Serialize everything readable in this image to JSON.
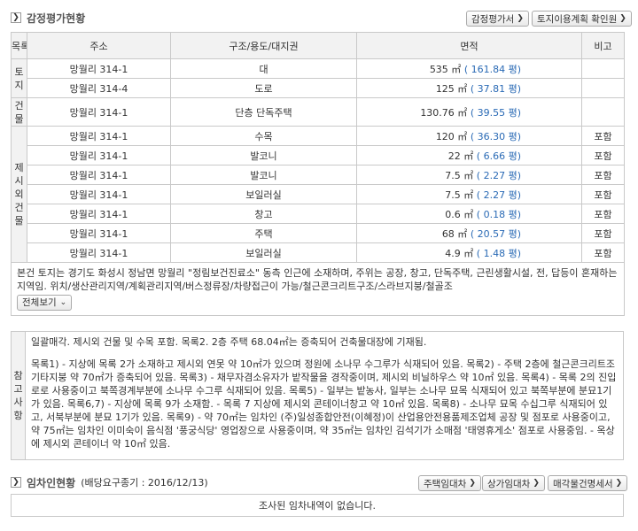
{
  "appraisal": {
    "title": "감정평가현황",
    "buttons": {
      "appraisal_doc": "감정평가서",
      "land_plan": "토지이용계획 확인원"
    },
    "headers": {
      "category": "목록",
      "address": "주소",
      "structure": "구조/용도/대지권",
      "area": "면적",
      "note": "비고"
    },
    "category_labels": {
      "land": "토지",
      "building": "건물",
      "extra": "제시외건물"
    },
    "land_rows": [
      {
        "address": "망월리 314-1",
        "structure": "대",
        "area": "535 ㎡",
        "pyeong": "( 161.84 평)",
        "note": ""
      },
      {
        "address": "망월리 314-4",
        "structure": "도로",
        "area": "125 ㎡",
        "pyeong": "( 37.81 평)",
        "note": ""
      }
    ],
    "building_rows": [
      {
        "address": "망월리 314-1",
        "structure": "단층 단독주택",
        "area": "130.76 ㎡",
        "pyeong": "( 39.55 평)",
        "note": ""
      }
    ],
    "extra_rows": [
      {
        "address": "망월리 314-1",
        "structure": "수목",
        "area": "120 ㎡",
        "pyeong": "( 36.30 평)",
        "note": "포함"
      },
      {
        "address": "망월리 314-1",
        "structure": "발코니",
        "area": "22 ㎡",
        "pyeong": "( 6.66 평)",
        "note": "포함"
      },
      {
        "address": "망월리 314-1",
        "structure": "발코니",
        "area": "7.5 ㎡",
        "pyeong": "( 2.27 평)",
        "note": "포함"
      },
      {
        "address": "망월리 314-1",
        "structure": "보일러실",
        "area": "7.5 ㎡",
        "pyeong": "( 2.27 평)",
        "note": "포함"
      },
      {
        "address": "망월리 314-1",
        "structure": "창고",
        "area": "0.6 ㎡",
        "pyeong": "( 0.18 평)",
        "note": "포함"
      },
      {
        "address": "망월리 314-1",
        "structure": "주택",
        "area": "68 ㎡",
        "pyeong": "( 20.57 평)",
        "note": "포함"
      },
      {
        "address": "망월리 314-1",
        "structure": "보일러실",
        "area": "4.9 ㎡",
        "pyeong": "( 1.48 평)",
        "note": "포함"
      }
    ],
    "description": "본건 토지는 경기도 화성시 정남면 망월리 \"정림보건진료소\" 동측 인근에 소재하며, 주위는 공장, 창고, 단독주택, 근린생활시설, 전, 답등이 혼재하는 지역임. 위치/생산관리지역/계획관리지역/버스정류장/차량접근이 가능/철근콘크리트구조/스라브지붕/철골조",
    "expand_label": "전체보기"
  },
  "notes": {
    "label": "참고사항",
    "paragraph1": "일괄매각. 제시외 건물 및 수목 포함. 목록2. 2층 주택 68.04㎡는 증축되어 건축물대장에 기재됨.",
    "paragraph2": "목록1) - 지상에 목록 2가 소재하고 제시외 연못 약 10㎡가 있으며 정원에 소나무 수그루가 식재되어 있음. 목록2) - 주택 2층에 철근콘크리트조기타지붕 약 70㎡가 증축되어 있음. 목록3) - 채무자겸소유자가 밭작물을 경작중이며, 제시외 비닐하우스 약 10㎡ 있음. 목록4) - 목록 2의 진입로로 사용중이고 북쪽경계부분에 소나무 수그루 식재되어 있음. 목록5) - 일부는 밭농사, 일부는 소나무 묘목 식재되어 있고 북쪽부분에 분묘1기가 있음. 목록6,7) - 지상에 목록 9가 소재함. - 목록 7 지상에 제시외 콘테이너창고 약 10㎡ 있음. 목록8) - 소나무 묘목 수십그루 식재되어 있고, 서북부분에 분묘 1기가 있음. 목록9) - 약 70㎡는 임차인 (주)일성종합안전(이혜정)이 산업용안전용품제조업체 공장 및 점포로 사용중이고, 약 75㎡는 임차인 이미숙이 음식점 '풍궁식당' 영업장으로 사용중이며, 약 35㎡는 임차인 김석기가 소매점 '태영휴게소' 점포로 사용중임. - 옥상에 제시외 콘테이너 약 10㎡ 있음."
  },
  "tenant": {
    "title": "임차인현황",
    "deadline": "(배당요구종기 : 2016/12/13)",
    "buttons": {
      "housing": "주택임대차",
      "commercial": "상가임대차",
      "statement": "매각물건명세서"
    },
    "empty_message": "조사된 임차내역이 없습니다."
  }
}
